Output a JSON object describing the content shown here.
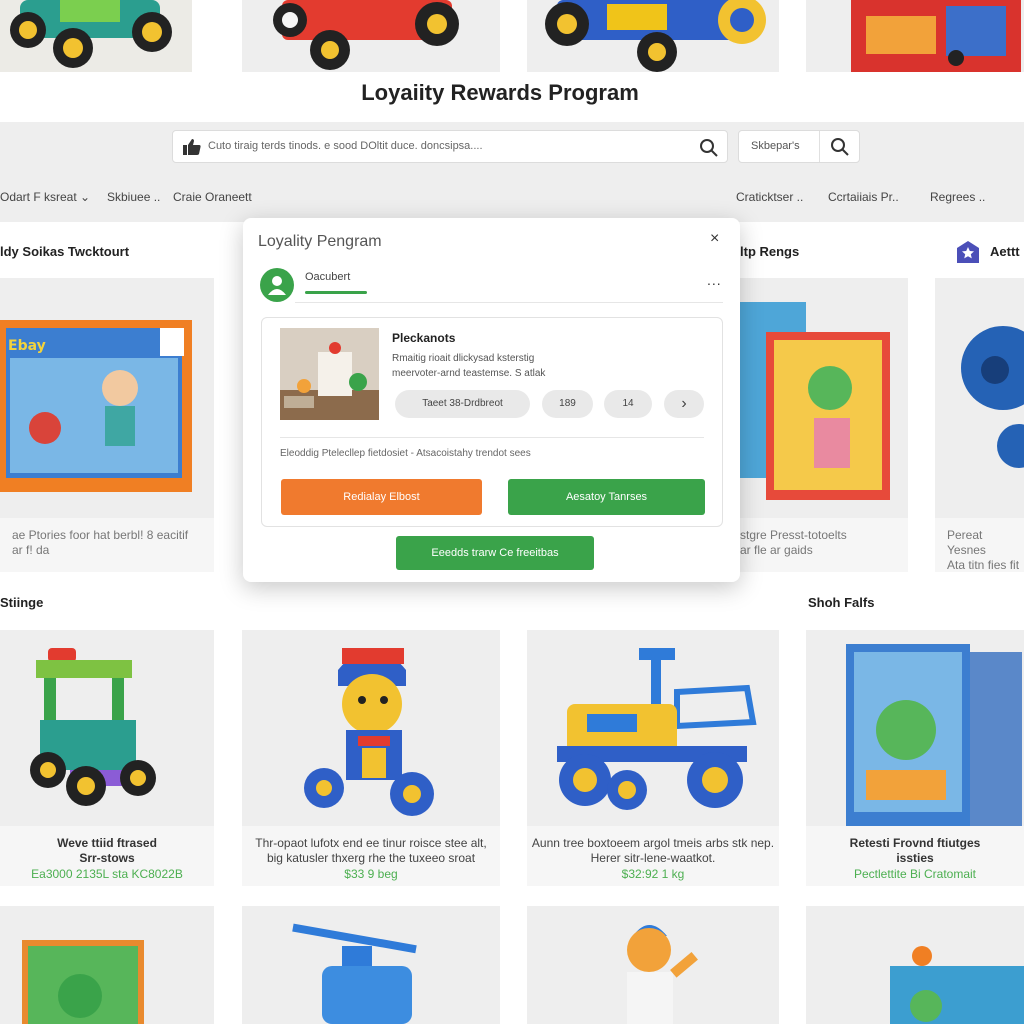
{
  "page_title": "Loyaiity Rewards Program",
  "search": {
    "placeholder": "Cuto tiraig terds tinods. e sood DOltit duce. doncsipsa....",
    "mini_label": "Skbepar's"
  },
  "nav": {
    "left": [
      "Odart F ksreat ⌄",
      "Skbiuee ..",
      "Craie Oraneett"
    ],
    "right": [
      "Craticktser ..",
      "Ccrtaiiais Pr..",
      "Regrees .."
    ]
  },
  "sections": {
    "row1_left": "ldy Soikas Twcktourt",
    "row1_right": "ltp Rengs",
    "row1_far_right": "Aettt",
    "row2_left": "Stiinge",
    "row2_right": "Shoh Falfs"
  },
  "row1_cards": {
    "left_text": [
      "ae Ptories foor hat berbl! 8 eacitif",
      "ar f! da"
    ],
    "right_text": [
      "stgre Presst-totoelts",
      "ar fle ar gaids"
    ],
    "far_right_text": [
      "Pereat Yesnes",
      "Ata titn fies fit"
    ]
  },
  "product_cards": [
    {
      "name": "Weve ttiid ftrased",
      "name2": "Srr-stows",
      "price": "Ea3000 2135L sta KC8022B"
    },
    {
      "desc": "Thr-opaot lufotx end ee tinur roisce stee alt,",
      "desc2": "big katusler thxerg rhe the tuxeeo sroat",
      "price": "$33 9 beg"
    },
    {
      "desc": "Aunn tree boxtoeem argol tmeis arbs stk nep.",
      "desc2": "Herer sitr-lene-waatkot.",
      "price": "$32:92 1 kg"
    },
    {
      "name": "Retesti Frovnd ftiutges",
      "name2": "issties",
      "price": "Pectlettite Bi Cratomait"
    }
  ],
  "modal": {
    "title": "Loyality Pengram",
    "close": "×",
    "user_name": "Oacubert",
    "more": "...",
    "reward_name": "Pleckanots",
    "reward_desc_1": "Rmaitig rioait dlickysad ksterstig",
    "reward_desc_2": "meervoter-arnd teastemse. S atlak",
    "pills": [
      "Taeet 38-Drdbreot",
      "189",
      "14",
      "›"
    ],
    "info_line": "Eleoddig Ptelecllep fietdosiet  -    Atsacoistahy trendot sees",
    "btn_redeem": "Redialay Elbost",
    "btn_activate": "Aesatoy Tanrses",
    "btn_footer": "Eeedds trarw Ce freeitbas"
  },
  "colors": {
    "accent_green": "#3aa34a",
    "accent_orange": "#f07a2e",
    "price_green": "#4caf50"
  }
}
